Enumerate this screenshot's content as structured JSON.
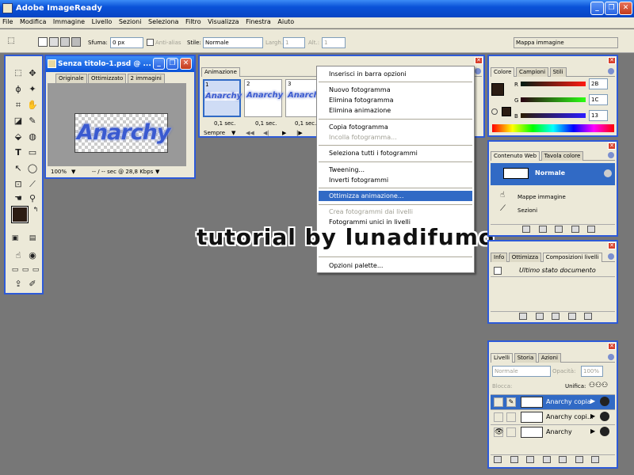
{
  "app": {
    "title": "Adobe ImageReady",
    "colors": {
      "titlebar": "#0a52d8",
      "chrome": "#ece9d8",
      "workspace": "#777777",
      "highlight": "#316ac5"
    }
  },
  "menubar": [
    "File",
    "Modifica",
    "Immagine",
    "Livello",
    "Sezioni",
    "Seleziona",
    "Filtro",
    "Visualizza",
    "Finestra",
    "Aiuto"
  ],
  "options": {
    "feather_label": "Sfuma:",
    "feather_value": "0 px",
    "antialias_label": "Anti-alias",
    "style_label": "Stile:",
    "style_value": "Normale",
    "width_label": "Largh.:",
    "width_value": "1",
    "height_label": "Alt.:",
    "height_value": "1",
    "imagemap_tab": "Mappa immagine"
  },
  "document": {
    "title": "Senza titolo-1.psd @ ...",
    "tabs": [
      "Originale",
      "Ottimizzato",
      "2 immagini"
    ],
    "image_text": "Anarchy",
    "zoom": "100%",
    "download": "-- / -- sec @ 28,8 Kbps"
  },
  "animation": {
    "tab": "Animazione",
    "frames": [
      {
        "num": "1",
        "delay": "0,1 sec."
      },
      {
        "num": "2",
        "delay": "0,1 sec."
      },
      {
        "num": "3",
        "delay": "0,1 sec."
      }
    ],
    "frame_text": "Anarchy",
    "loop": "Sempre"
  },
  "menu": {
    "items": [
      {
        "label": "Inserisci in barra opzioni",
        "enabled": true
      },
      {
        "label": "Nuovo fotogramma",
        "enabled": true
      },
      {
        "label": "Elimina fotogramma",
        "enabled": true
      },
      {
        "label": "Elimina animazione",
        "enabled": true
      },
      {
        "label": "Copia fotogramma",
        "enabled": true
      },
      {
        "label": "Incolla fotogramma...",
        "enabled": false
      },
      {
        "label": "Seleziona tutti i fotogrammi",
        "enabled": true
      },
      {
        "label": "Tweening...",
        "enabled": true
      },
      {
        "label": "Inverti fotogrammi",
        "enabled": true
      },
      {
        "label": "Ottimizza animazione...",
        "enabled": true,
        "highlighted": true
      },
      {
        "label": "Crea fotogrammi dai livelli",
        "enabled": false
      },
      {
        "label": "Fotogrammi unici in livelli",
        "enabled": true
      },
      {
        "label": "Opzioni palette...",
        "enabled": true
      }
    ]
  },
  "watermark": "tutorial by lunadifumo",
  "color_panel": {
    "tabs": [
      "Colore",
      "Campioni",
      "Stili"
    ],
    "r_label": "R",
    "r_value": "2B",
    "g_label": "G",
    "g_value": "1C",
    "b_label": "B",
    "b_value": "13",
    "foreground": "#2b1c13"
  },
  "web_panel": {
    "tabs": [
      "Contenuto Web",
      "Tavola colore"
    ],
    "state": "Normale",
    "imagemap": "Mappe immagine",
    "slices": "Sezioni"
  },
  "history_panel": {
    "tabs": [
      "Info",
      "Ottimizza",
      "Composizioni livelli"
    ],
    "item": "Ultimo stato documento"
  },
  "layers_panel": {
    "tabs": [
      "Livelli",
      "Storia",
      "Azioni"
    ],
    "blend": "Normale",
    "opacity_label": "Opacità:",
    "opacity_value": "100%",
    "lock_label": "Blocca:",
    "unify_label": "Unifica:",
    "layers": [
      {
        "name": "Anarchy copia",
        "selected": true
      },
      {
        "name": "Anarchy copi...",
        "selected": false
      },
      {
        "name": "Anarchy",
        "selected": false,
        "visible": true
      }
    ]
  }
}
